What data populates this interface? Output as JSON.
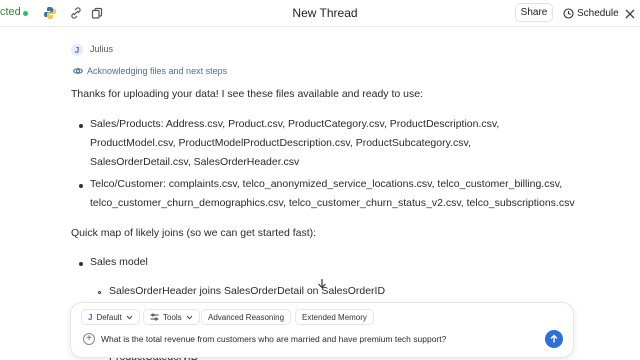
{
  "topbar": {
    "connection_label": "cted",
    "title": "New Thread",
    "share_label": "Share",
    "schedule_label": "Schedule"
  },
  "message": {
    "avatar_initial": "J",
    "author": "Julius",
    "reasoning_label": "Acknowledging files and next steps",
    "intro": "Thanks for uploading your data! I see these files available and ready to use:",
    "bullets": [
      {
        "lines": [
          "Sales/Products: Address.csv, Product.csv, ProductCategory.csv, ProductDescription.csv,",
          "ProductModel.csv, ProductModelProductDescription.csv, ProductSubcategory.csv,",
          "SalesOrderDetail.csv, SalesOrderHeader.csv"
        ]
      },
      {
        "lines": [
          "Telco/Customer: complaints.csv, telco_anonymized_service_locations.csv, telco_customer_billing.csv,",
          "telco_customer_churn_demographics.csv, telco_customer_churn_status_v2.csv, telco_subscriptions.csv"
        ]
      }
    ],
    "joins_intro": "Quick map of likely joins (so we can get started fast):",
    "sales_model": "Sales model",
    "join_line": "SalesOrderHeader joins SalesOrderDetail on SalesOrderID",
    "cut_line": "ProductCategoryID"
  },
  "composer": {
    "model_chip": "Default",
    "tools_chip": "Tools",
    "reasoning_chip": "Advanced Reasoning",
    "memory_chip": "Extended Memory",
    "prompt_text": "What is the total revenue from customers who are married and have premium tech support?"
  },
  "colors": {
    "accent": "#2f6fd8",
    "connected": "#22c55e"
  }
}
